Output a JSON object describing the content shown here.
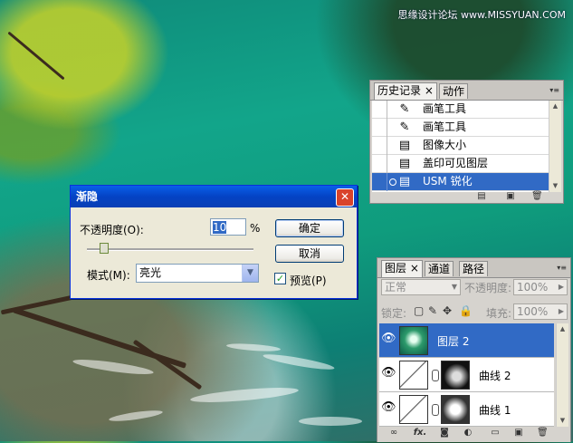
{
  "watermark": "思缘设计论坛 www.MISSYUAN.COM",
  "fade_dialog": {
    "title": "渐隐",
    "close_glyph": "✕",
    "opacity_label": "不透明度(O):",
    "opacity_value": "10",
    "opacity_unit": "%",
    "mode_label": "模式(M):",
    "mode_value": "亮光",
    "ok_label": "确定",
    "cancel_label": "取消",
    "preview_label": "预览(P)",
    "preview_checked": true,
    "opacity_slider_fraction": 0.1
  },
  "history_panel": {
    "tabs": [
      {
        "label": "历史记录",
        "close": "×",
        "active": true
      },
      {
        "label": "动作",
        "active": false
      }
    ],
    "items": [
      {
        "label": "画笔工具",
        "icon": "brush-icon",
        "glyph": "✎",
        "selected": false
      },
      {
        "label": "画笔工具",
        "icon": "brush-icon",
        "glyph": "✎",
        "selected": false
      },
      {
        "label": "图像大小",
        "icon": "image-size-icon",
        "glyph": "▤",
        "selected": false
      },
      {
        "label": "盖印可见图层",
        "icon": "stamp-layers-icon",
        "glyph": "▤",
        "selected": false
      },
      {
        "label": "USM 锐化",
        "icon": "filter-icon",
        "glyph": "▤",
        "selected": true
      }
    ]
  },
  "layers_panel": {
    "tabs": [
      {
        "label": "图层",
        "close": "×",
        "active": true
      },
      {
        "label": "通道",
        "active": false
      },
      {
        "label": "路径",
        "active": false
      }
    ],
    "blend_mode": "正常",
    "opacity_label": "不透明度:",
    "opacity_value": "100%",
    "lock_label": "锁定:",
    "fill_label": "填充:",
    "fill_value": "100%",
    "layers": [
      {
        "name": "图层 2",
        "selected": true,
        "type": "pixel"
      },
      {
        "name": "曲线 2",
        "selected": false,
        "type": "adjustment"
      },
      {
        "name": "曲线 1",
        "selected": false,
        "type": "adjustment"
      }
    ],
    "footer_fx": "fx."
  },
  "colors": {
    "selection": "#316ac5",
    "titlebar": "#0a5fe8",
    "panel_bg": "#d6d3ce",
    "dialog_bg": "#ece9d8"
  }
}
